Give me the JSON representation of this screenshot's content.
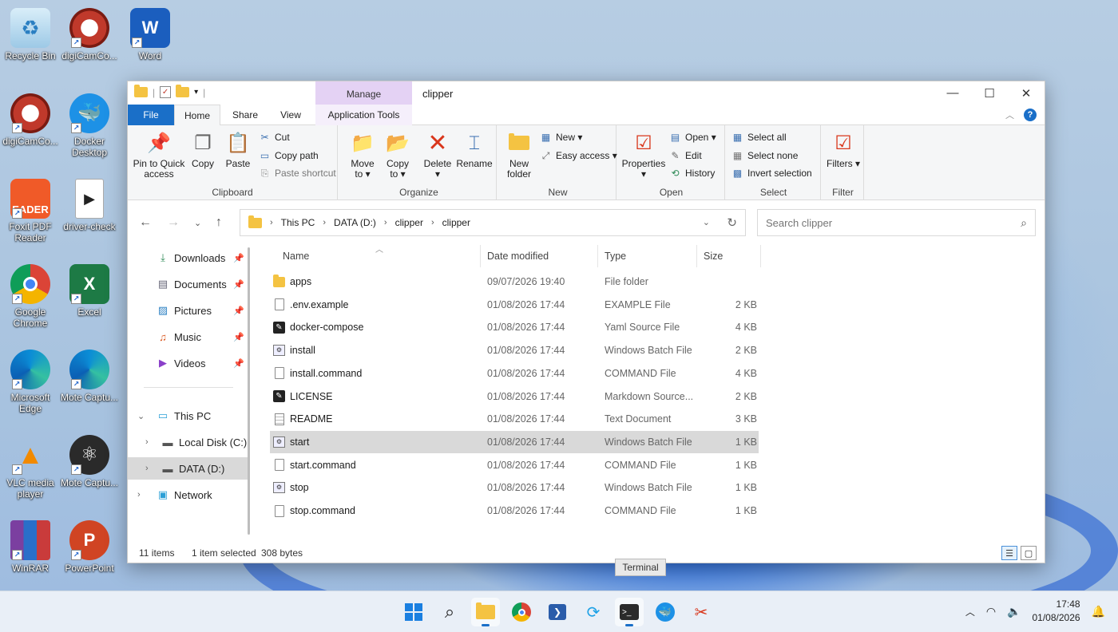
{
  "desktop": {
    "icons": [
      {
        "label": "Recycle Bin",
        "icon": "recycle-bin-icon"
      },
      {
        "label": "digiCamCo...",
        "icon": "digicam-icon"
      },
      {
        "label": "Word",
        "icon": "word-icon"
      },
      {
        "label": "digiCamCo...",
        "icon": "digicam-icon"
      },
      {
        "label": "Docker Desktop",
        "icon": "docker-icon"
      },
      {
        "label": "Foxit PDF Reader",
        "icon": "foxit-icon"
      },
      {
        "label": "driver-check",
        "icon": "video-icon"
      },
      {
        "label": "Google Chrome",
        "icon": "chrome-icon"
      },
      {
        "label": "Excel",
        "icon": "excel-icon"
      },
      {
        "label": "Microsoft Edge",
        "icon": "edge-icon"
      },
      {
        "label": "Mote Captu...",
        "icon": "edge-icon"
      },
      {
        "label": "VLC media player",
        "icon": "vlc-icon"
      },
      {
        "label": "Mote Captu...",
        "icon": "mote-icon"
      },
      {
        "label": "WinRAR",
        "icon": "winrar-icon"
      },
      {
        "label": "PowerPoint",
        "icon": "powerpoint-icon"
      }
    ],
    "foxit_text": "EADER",
    "word_letter": "W",
    "excel_letter": "X",
    "ppt_letter": "P"
  },
  "window": {
    "title": "clipper",
    "manage_label": "Manage",
    "controls": {
      "minimize": "—",
      "maximize": "☐",
      "close": "✕"
    }
  },
  "tabs": {
    "file": "File",
    "home": "Home",
    "share": "Share",
    "view": "View",
    "app_tools": "Application Tools"
  },
  "ribbon": {
    "clipboard": {
      "label": "Clipboard",
      "pin": "Pin to Quick access",
      "copy": "Copy",
      "paste": "Paste",
      "cut": "Cut",
      "copy_path": "Copy path",
      "paste_shortcut": "Paste shortcut"
    },
    "organize": {
      "label": "Organize",
      "move_to": "Move to ▾",
      "copy_to": "Copy to ▾",
      "delete": "Delete ▾",
      "rename": "Rename"
    },
    "new": {
      "label": "New",
      "new_folder": "New folder",
      "new_item": "New ▾",
      "easy_access": "Easy access ▾"
    },
    "open": {
      "label": "Open",
      "properties": "Properties ▾",
      "open": "Open ▾",
      "edit": "Edit",
      "history": "History"
    },
    "select": {
      "label": "Select",
      "select_all": "Select all",
      "select_none": "Select none",
      "invert": "Invert selection"
    },
    "filter": {
      "label": "Filter",
      "filters": "Filters ▾"
    }
  },
  "address": {
    "crumbs": [
      "This PC",
      "DATA (D:)",
      "clipper",
      "clipper"
    ],
    "search_placeholder": "Search clipper"
  },
  "nav_pane": {
    "quick": [
      {
        "label": "Downloads",
        "icon": "download-arrow-icon"
      },
      {
        "label": "Documents",
        "icon": "documents-icon"
      },
      {
        "label": "Pictures",
        "icon": "pictures-icon"
      },
      {
        "label": "Music",
        "icon": "music-icon"
      },
      {
        "label": "Videos",
        "icon": "videos-icon"
      }
    ],
    "this_pc": "This PC",
    "local_disk": "Local Disk (C:)",
    "data_drive": "DATA (D:)",
    "network": "Network"
  },
  "columns": {
    "name": "Name",
    "date": "Date modified",
    "type": "Type",
    "size": "Size"
  },
  "files": [
    {
      "name": "apps",
      "date": "09/07/2026 19:40",
      "type": "File folder",
      "size": "",
      "icon": "folder-icon"
    },
    {
      "name": ".env.example",
      "date": "01/08/2026 17:44",
      "type": "EXAMPLE File",
      "size": "2 KB",
      "icon": "document-icon"
    },
    {
      "name": "docker-compose",
      "date": "01/08/2026 17:44",
      "type": "Yaml Source File",
      "size": "4 KB",
      "icon": "yaml-file-icon"
    },
    {
      "name": "install",
      "date": "01/08/2026 17:44",
      "type": "Windows Batch File",
      "size": "2 KB",
      "icon": "batch-file-icon"
    },
    {
      "name": "install.command",
      "date": "01/08/2026 17:44",
      "type": "COMMAND File",
      "size": "4 KB",
      "icon": "document-icon"
    },
    {
      "name": "LICENSE",
      "date": "01/08/2026 17:44",
      "type": "Markdown Source...",
      "size": "2 KB",
      "icon": "markdown-file-icon"
    },
    {
      "name": "README",
      "date": "01/08/2026 17:44",
      "type": "Text Document",
      "size": "3 KB",
      "icon": "text-file-icon"
    },
    {
      "name": "start",
      "date": "01/08/2026 17:44",
      "type": "Windows Batch File",
      "size": "1 KB",
      "icon": "batch-file-icon",
      "selected": true
    },
    {
      "name": "start.command",
      "date": "01/08/2026 17:44",
      "type": "COMMAND File",
      "size": "1 KB",
      "icon": "document-icon"
    },
    {
      "name": "stop",
      "date": "01/08/2026 17:44",
      "type": "Windows Batch File",
      "size": "1 KB",
      "icon": "batch-file-icon"
    },
    {
      "name": "stop.command",
      "date": "01/08/2026 17:44",
      "type": "COMMAND File",
      "size": "1 KB",
      "icon": "document-icon"
    }
  ],
  "status": {
    "items": "11 items",
    "selected": "1 item selected",
    "bytes": "308 bytes"
  },
  "tooltip": "Terminal",
  "taskbar": {
    "time": "17:48",
    "date": "01/08/2026"
  },
  "colors": {
    "accent": "#1a6fc8",
    "manage_tab": "#e4d2f4",
    "folder": "#f4c342",
    "selection": "#d9d9d9"
  }
}
